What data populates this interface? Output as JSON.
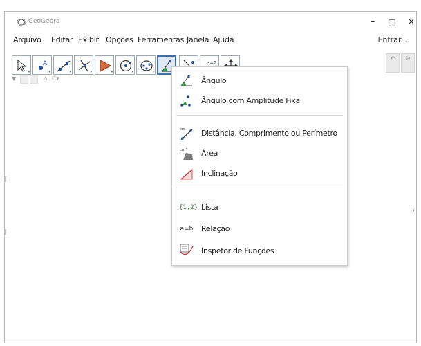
{
  "window": {
    "title": "GeoGebra",
    "minimize": "–",
    "maximize": "□",
    "close": "✕"
  },
  "menubar": {
    "items": [
      "Arquivo",
      "Editar",
      "Exibir",
      "Opções",
      "Ferramentas",
      "Janela",
      "Ajuda"
    ],
    "signin": "Entrar..."
  },
  "toolbar": {
    "tools": [
      "move-tool",
      "point-tool",
      "line-tool",
      "perpendicular-line-tool",
      "polygon-tool",
      "circle-tool",
      "conic-tool",
      "angle-tool",
      "reflect-tool",
      "slider-tool",
      "move-graphics-view-tool"
    ],
    "selected_index": 7
  },
  "right_controls": {
    "undo": "↶",
    "settings": "⚙"
  },
  "viewbar": {
    "home": "⌂",
    "view": "C▾"
  },
  "dropdown": {
    "items": [
      {
        "label": "Ângulo",
        "icon": "angle-icon"
      },
      {
        "label": "Ângulo com Amplitude Fixa",
        "icon": "angle-fixed-size-icon"
      },
      {
        "label": "Distância, Comprimento ou Perímetro",
        "icon": "distance-icon"
      },
      {
        "label": "Área",
        "icon": "area-icon"
      },
      {
        "label": "Inclinação",
        "icon": "slope-icon"
      },
      {
        "label": "Lista",
        "icon": "list-icon",
        "icon_text": "{1,2}"
      },
      {
        "label": "Relação",
        "icon": "relation-icon",
        "icon_text": "a=b"
      },
      {
        "label": "Inspetor de Funções",
        "icon": "function-inspector-icon"
      }
    ]
  }
}
